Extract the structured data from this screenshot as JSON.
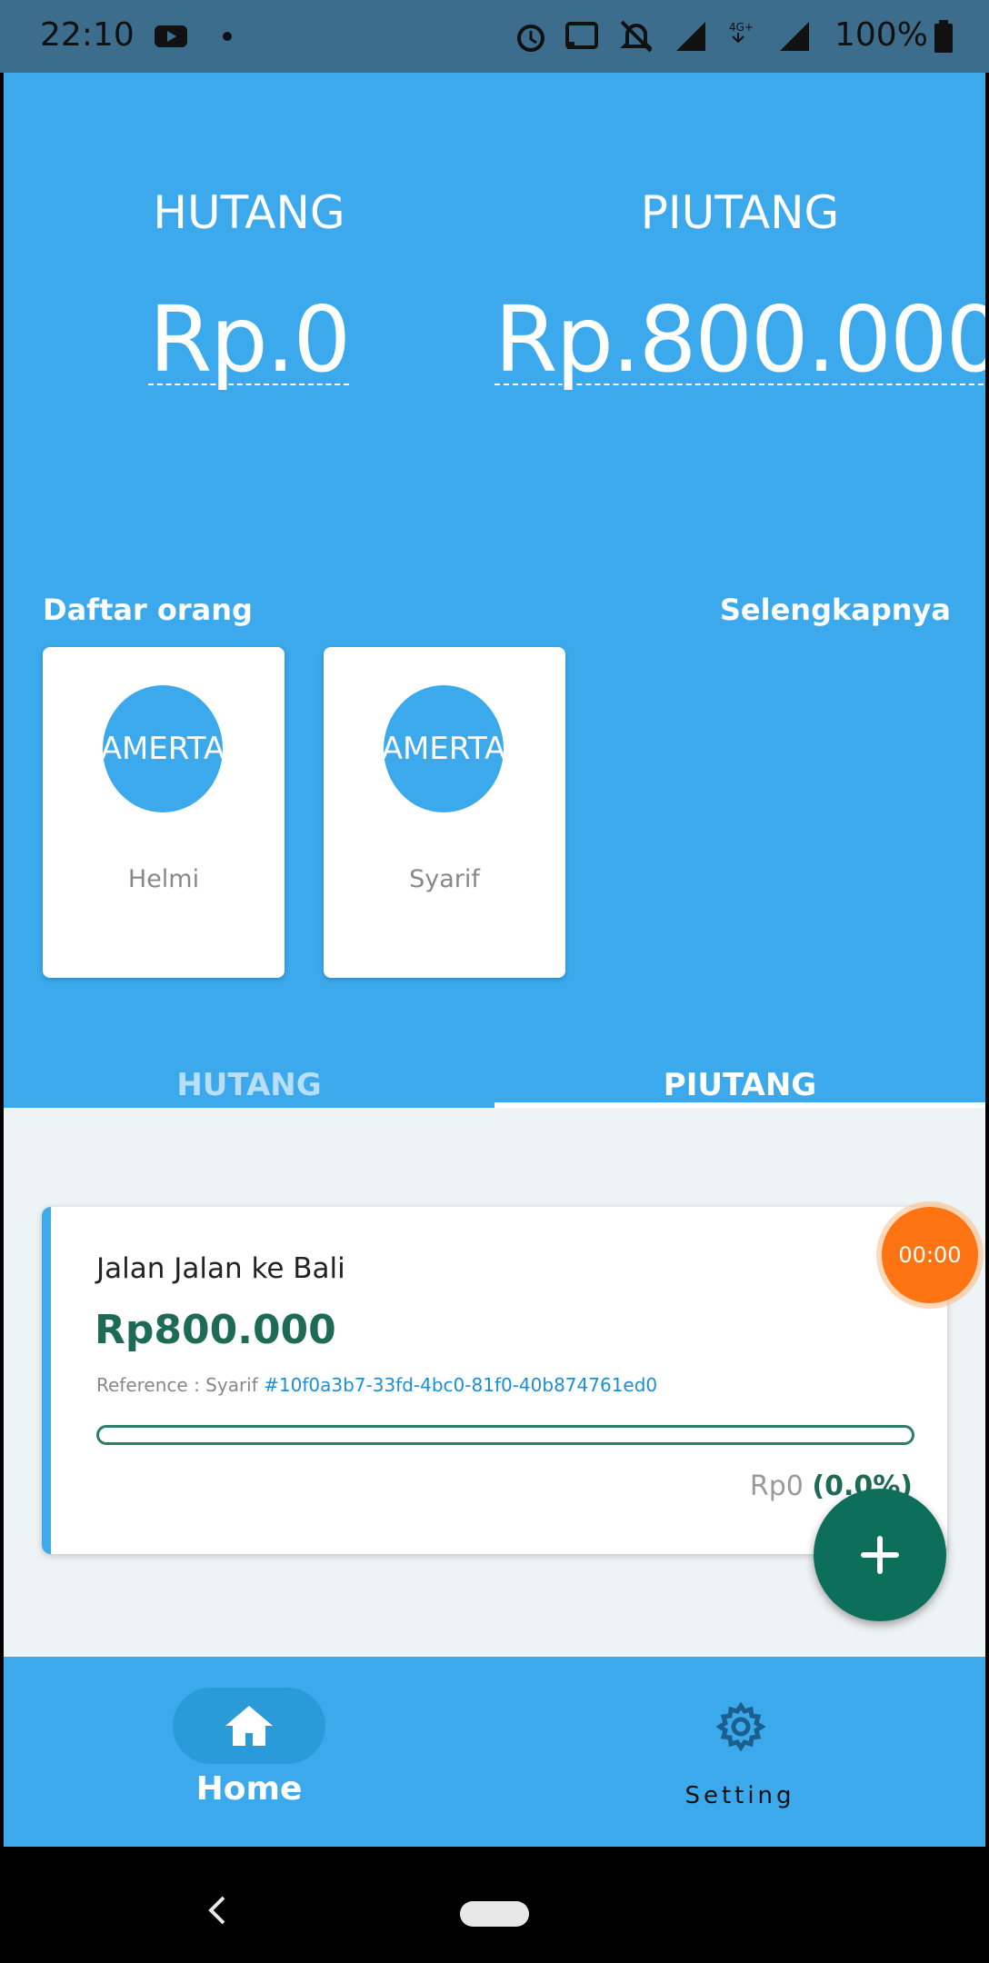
{
  "status_bar": {
    "time": "22:10",
    "battery": "100%",
    "icons": [
      "youtube-icon",
      "dot-icon",
      "alarm-icon",
      "cast-icon",
      "notifications-off-icon",
      "signal-icon",
      "4g-signal-icon",
      "battery-icon"
    ]
  },
  "summary": {
    "hutang_label": "HUTANG",
    "hutang_value": "Rp.0",
    "piutang_label": "PIUTANG",
    "piutang_value": "Rp.800.000"
  },
  "people": {
    "title": "Daftar orang",
    "more_label": "Selengkapnya",
    "items": [
      {
        "avatar_text": "AMERTA",
        "name": "Helmi"
      },
      {
        "avatar_text": "AMERTA",
        "name": "Syarif"
      }
    ]
  },
  "tabs": [
    {
      "label": "HUTANG",
      "active": false
    },
    {
      "label": "PIUTANG",
      "active": true
    }
  ],
  "debts": [
    {
      "title": "Jalan Jalan ke Bali",
      "amount": "Rp800.000",
      "reference_prefix": "Reference : Syarif",
      "reference_id": "#10f0a3b7-33fd-4bc0-81f0-40b874761ed0",
      "paid": "Rp0",
      "paid_percent": "(0.0%)",
      "progress_fraction": 0.0
    }
  ],
  "timer": "00:00",
  "bottom_nav": {
    "home_label": "Home",
    "setting_label": "Setting",
    "active": "home"
  },
  "colors": {
    "primary": "#3ba9ec",
    "accent_green": "#0d6e5a",
    "timer_orange": "#ff7412"
  }
}
